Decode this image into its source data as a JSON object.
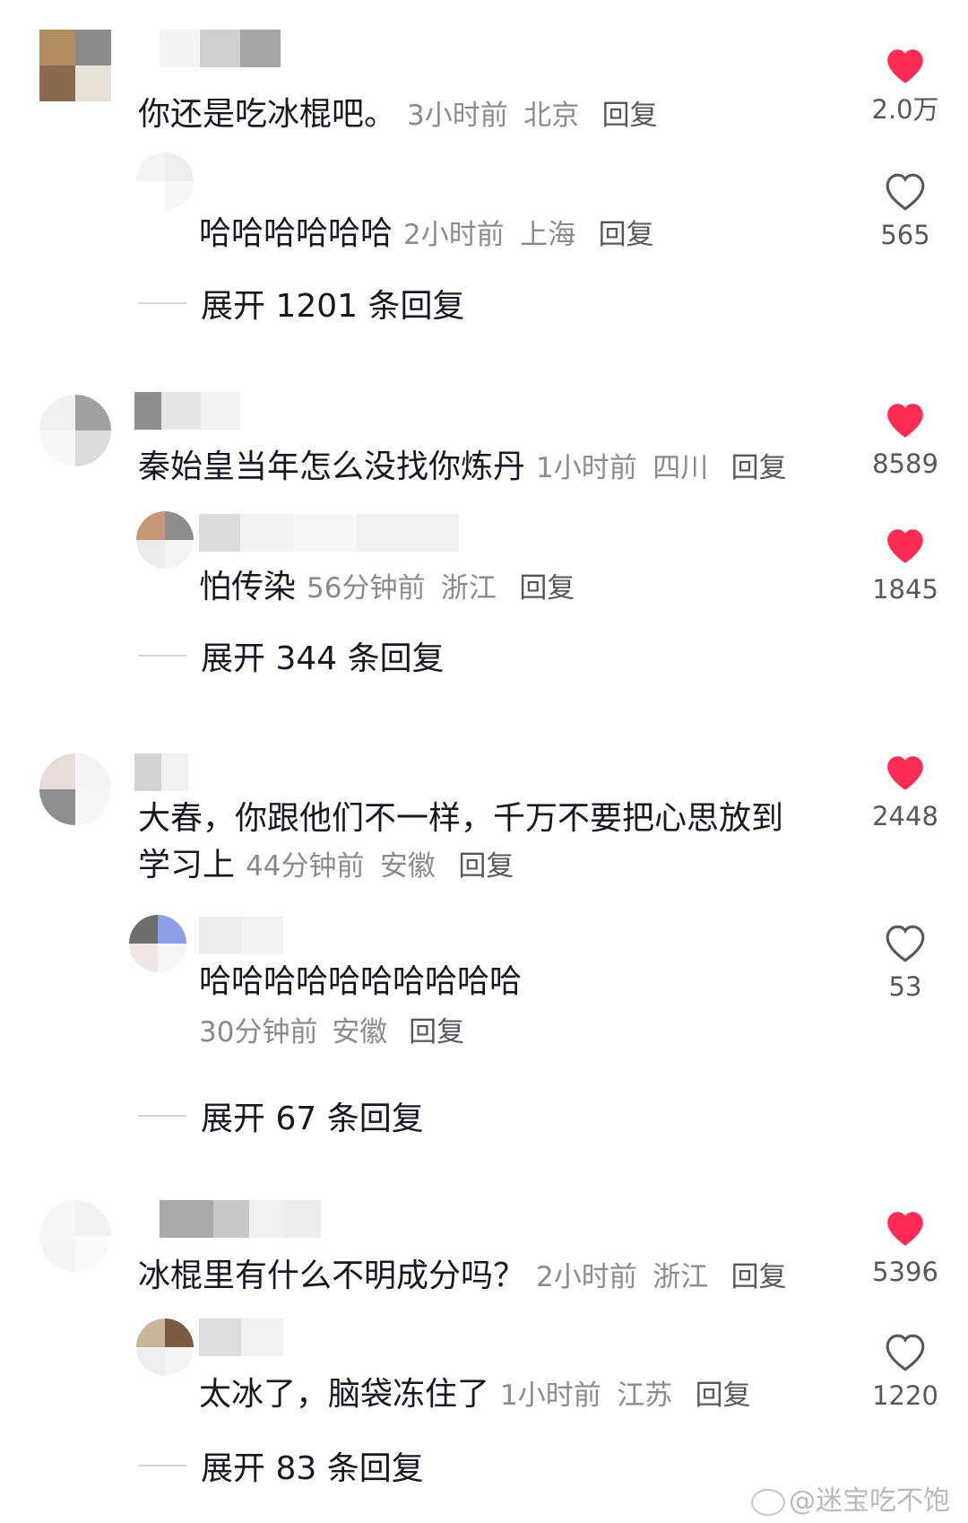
{
  "comments": [
    {
      "text": "你还是吃冰棍吧。",
      "time": "3小时前",
      "location": "北京",
      "reply_label": "回复",
      "likes": "2.0万",
      "liked": true,
      "sub": {
        "text": "哈哈哈哈哈哈",
        "time": "2小时前",
        "location": "上海",
        "reply_label": "回复",
        "likes": "565",
        "liked": false
      },
      "expand_label": "展开 1201 条回复"
    },
    {
      "text": "秦始皇当年怎么没找你炼丹",
      "time": "1小时前",
      "location": "四川",
      "reply_label": "回复",
      "likes": "8589",
      "liked": true,
      "sub": {
        "text": "怕传染",
        "time": "56分钟前",
        "location": "浙江",
        "reply_label": "回复",
        "likes": "1845",
        "liked": true
      },
      "expand_label": "展开 344 条回复"
    },
    {
      "text_line1": "大春，你跟他们不一样，千万不要把心思放到",
      "text_line2": "学习上",
      "time": "44分钟前",
      "location": "安徽",
      "reply_label": "回复",
      "likes": "2448",
      "liked": true,
      "sub": {
        "text": "哈哈哈哈哈哈哈哈哈哈",
        "time": "30分钟前",
        "location": "安徽",
        "reply_label": "回复",
        "likes": "53",
        "liked": false
      },
      "expand_label": "展开 67 条回复"
    },
    {
      "text": "冰棍里有什么不明成分吗？",
      "time": "2小时前",
      "location": "浙江",
      "reply_label": "回复",
      "likes": "5396",
      "liked": true,
      "sub": {
        "text": "太冰了，脑袋冻住了",
        "time": "1小时前",
        "location": "江苏",
        "reply_label": "回复",
        "likes": "1220",
        "liked": false
      },
      "expand_label": "展开 83 条回复"
    }
  ],
  "watermark": "@迷宝吃不饱",
  "colors": {
    "heart_filled": "#fe2c55",
    "heart_outline": "#57585f",
    "meta": "#8a8b91",
    "text": "#161823"
  },
  "icons": {
    "liked": "heart-filled-icon",
    "not_liked": "heart-outline-icon",
    "watermark": "weibo-icon"
  }
}
